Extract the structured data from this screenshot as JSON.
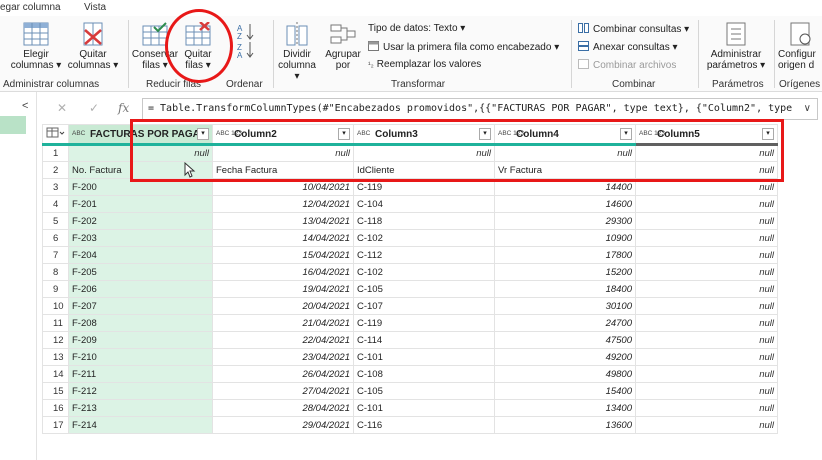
{
  "tabs": [
    "egar columna",
    "Vista"
  ],
  "ribbon": {
    "groups": [
      {
        "label": "Administrar columnas"
      },
      {
        "label": "Reducir filas"
      },
      {
        "label": "Ordenar"
      },
      {
        "label": "Transformar"
      },
      {
        "label": "Combinar"
      },
      {
        "label": "Parámetros"
      },
      {
        "label": "Orígenes d"
      }
    ],
    "buttons": {
      "elegir": [
        "Elegir",
        "columnas ▾"
      ],
      "quitar_cols": [
        "Quitar",
        "columnas ▾"
      ],
      "conservar": [
        "Conservar",
        "filas ▾"
      ],
      "quitar_filas": [
        "Quitar",
        "filas ▾"
      ],
      "dividir": [
        "Dividir",
        "columna ▾"
      ],
      "agrupar": [
        "Agrupar",
        "por"
      ],
      "administrar": [
        "Administrar",
        "parámetros ▾"
      ],
      "configurar": [
        "Configur",
        "origen d"
      ]
    },
    "small": {
      "tipo_datos": "Tipo de datos: Texto ▾",
      "primera_fila": "Usar la primera fila como encabezado ▾",
      "reemplazar": "Reemplazar los valores",
      "combinar_consultas": "Combinar consultas ▾",
      "anexar": "Anexar consultas ▾",
      "combinar_archivos": "Combinar archivos"
    }
  },
  "formula": {
    "fx": "fx",
    "text": "= Table.TransformColumnTypes(#\"Encabezados promovidos\",{{\"FACTURAS POR PAGAR\", type text}, {\"Column2\", type",
    "expand": "∨"
  },
  "table": {
    "columns": [
      {
        "type": "ABC",
        "name": "FACTURAS POR PAGAR"
      },
      {
        "type": "ABC 123",
        "name": "Column2"
      },
      {
        "type": "ABC",
        "name": "Column3"
      },
      {
        "type": "ABC 123",
        "name": "Column4"
      },
      {
        "type": "ABC 123",
        "name": "Column5"
      }
    ],
    "rows": [
      [
        "1",
        "null",
        "null",
        "null",
        "null",
        "null"
      ],
      [
        "2",
        "No. Factura",
        "Fecha Factura",
        "IdCliente",
        "Vr Factura",
        "null"
      ],
      [
        "3",
        "F-200",
        "10/04/2021",
        "C-119",
        "14400",
        "null"
      ],
      [
        "4",
        "F-201",
        "12/04/2021",
        "C-104",
        "14600",
        "null"
      ],
      [
        "5",
        "F-202",
        "13/04/2021",
        "C-118",
        "29300",
        "null"
      ],
      [
        "6",
        "F-203",
        "14/04/2021",
        "C-102",
        "10900",
        "null"
      ],
      [
        "7",
        "F-204",
        "15/04/2021",
        "C-112",
        "17800",
        "null"
      ],
      [
        "8",
        "F-205",
        "16/04/2021",
        "C-102",
        "15200",
        "null"
      ],
      [
        "9",
        "F-206",
        "19/04/2021",
        "C-105",
        "18400",
        "null"
      ],
      [
        "10",
        "F-207",
        "20/04/2021",
        "C-107",
        "30100",
        "null"
      ],
      [
        "11",
        "F-208",
        "21/04/2021",
        "C-119",
        "24700",
        "null"
      ],
      [
        "12",
        "F-209",
        "22/04/2021",
        "C-114",
        "47500",
        "null"
      ],
      [
        "13",
        "F-210",
        "23/04/2021",
        "C-101",
        "49200",
        "null"
      ],
      [
        "14",
        "F-211",
        "26/04/2021",
        "C-108",
        "49800",
        "null"
      ],
      [
        "15",
        "F-212",
        "27/04/2021",
        "C-105",
        "15400",
        "null"
      ],
      [
        "16",
        "F-213",
        "28/04/2021",
        "C-101",
        "13400",
        "null"
      ],
      [
        "17",
        "F-214",
        "29/04/2021",
        "C-116",
        "13600",
        "null"
      ]
    ]
  },
  "colors": {
    "accent": "#1fb29b",
    "highlight": "#e81818",
    "selected": "#c9ead4"
  }
}
